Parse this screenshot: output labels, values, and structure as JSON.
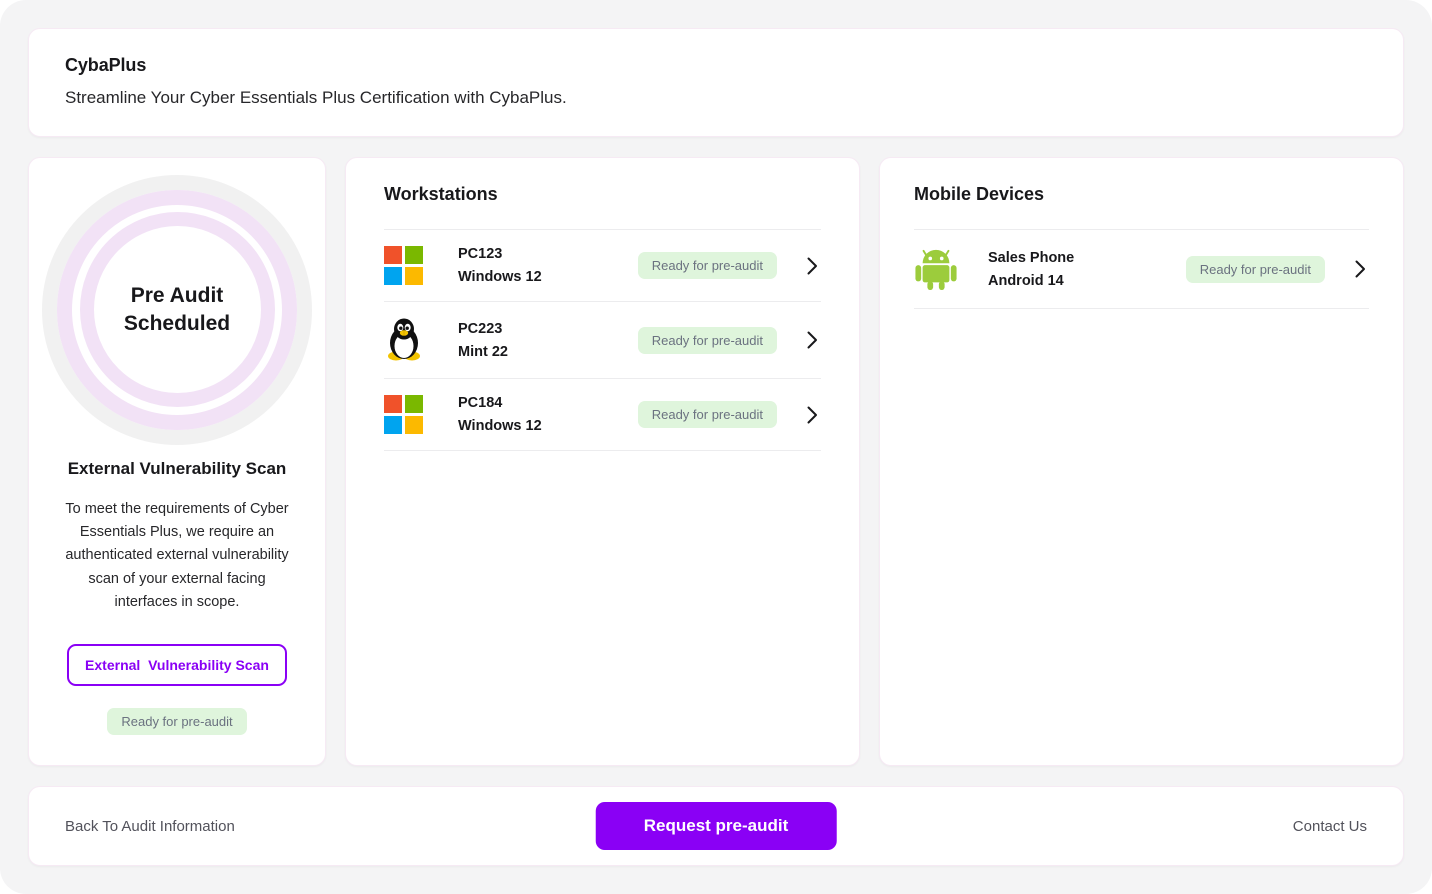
{
  "header": {
    "title": "CybaPlus",
    "subtitle": "Streamline Your Cyber Essentials Plus Certification with CybaPlus."
  },
  "status_panel": {
    "ring_label": "Pre Audit Scheduled",
    "ring_colors": {
      "gray": "#f1f1f1",
      "purple": "#f2e2f6"
    },
    "scan_title": "External Vulnerability Scan",
    "scan_description": "To meet the requirements of Cyber Essentials Plus, we require an authenticated external vulnerability scan of your external facing interfaces in scope.",
    "scan_button_label": "External  Vulnerability Scan",
    "scan_status_badge": "Ready for pre-audit"
  },
  "workstations": {
    "title": "Workstations",
    "rows": [
      {
        "icon": "windows-logo-icon",
        "name": "PC123",
        "os": "Windows 12",
        "status": "Ready for pre-audit",
        "chevron": "chevron-right-icon"
      },
      {
        "icon": "linux-penguin-icon",
        "name": "PC223",
        "os": "Mint 22",
        "status": "Ready for pre-audit",
        "chevron": "chevron-right-icon"
      },
      {
        "icon": "windows-logo-icon",
        "name": "PC184",
        "os": "Windows 12",
        "status": "Ready for pre-audit",
        "chevron": "chevron-right-icon"
      }
    ]
  },
  "mobile_devices": {
    "title": "Mobile Devices",
    "rows": [
      {
        "icon": "android-robot-icon",
        "name": "Sales Phone",
        "os": "Android 14",
        "status": "Ready for pre-audit",
        "chevron": "chevron-right-icon"
      }
    ]
  },
  "footer": {
    "back_link": "Back To Audit Information",
    "primary_button": "Request pre-audit",
    "contact_link": "Contact Us"
  },
  "colors": {
    "accent_purple": "#8a00f5",
    "badge_green_bg": "#dff5dc",
    "page_background": "#f4f4f5"
  }
}
